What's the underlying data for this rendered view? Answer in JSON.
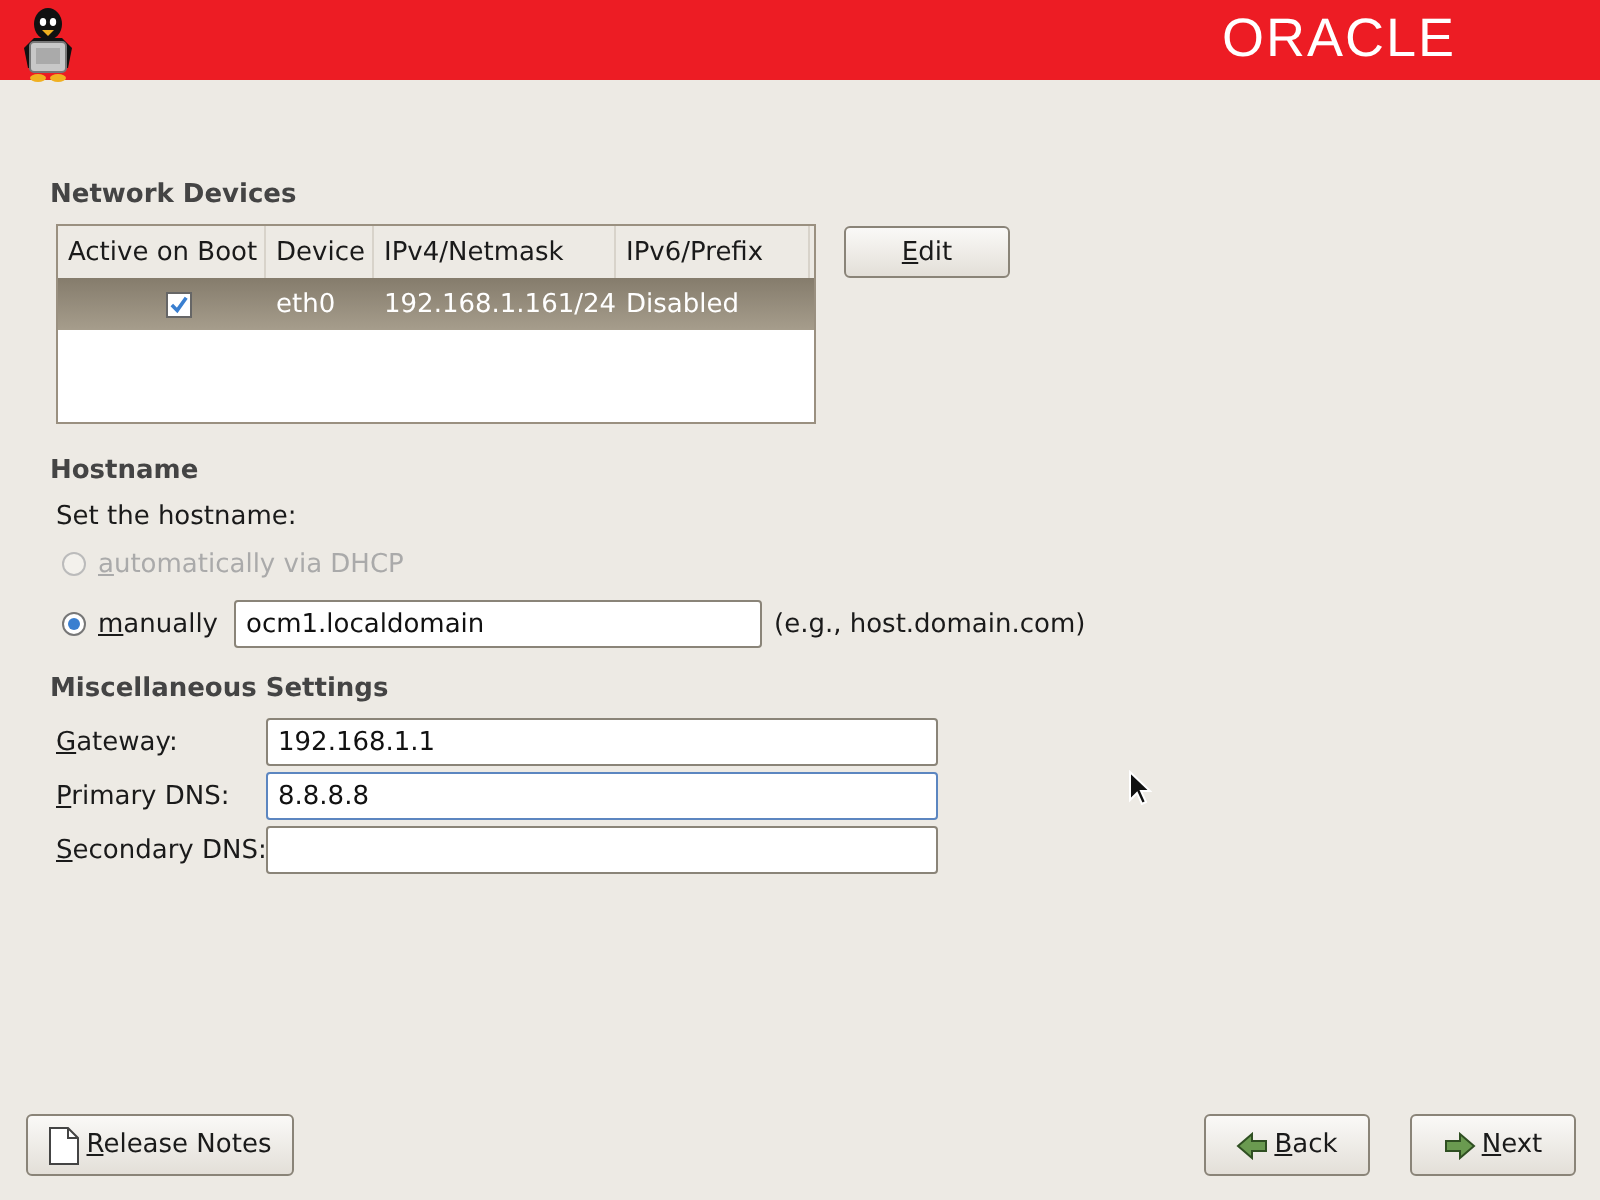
{
  "header": {
    "logo": "ORACLE"
  },
  "network_devices": {
    "title": "Network Devices",
    "columns": [
      "Active on Boot",
      "Device",
      "IPv4/Netmask",
      "IPv6/Prefix"
    ],
    "rows": [
      {
        "active_on_boot": true,
        "device": "eth0",
        "ipv4": "192.168.1.161/24",
        "ipv6": "Disabled",
        "selected": true
      }
    ],
    "edit_button": "Edit"
  },
  "hostname": {
    "title": "Hostname",
    "prompt": "Set the hostname:",
    "options": [
      {
        "kind": "radio",
        "label": "automatically via DHCP",
        "selected": false,
        "disabled": true
      },
      {
        "kind": "radio_field",
        "label": "manually",
        "selected": true,
        "disabled": false,
        "value": "ocm1.localdomain",
        "hint": "(e.g., host.domain.com)"
      }
    ]
  },
  "misc": {
    "title": "Miscellaneous Settings",
    "fields": [
      {
        "label": "Gateway:",
        "value": "192.168.1.1",
        "focused": false
      },
      {
        "label": "Primary DNS:",
        "value": "8.8.8.8",
        "focused": true
      },
      {
        "label": "Secondary DNS:",
        "focused": false
      }
    ]
  },
  "buttons": [
    {
      "kind": "notes",
      "label": "Release Notes"
    },
    {
      "kind": "back",
      "label": "Back"
    },
    {
      "kind": "next",
      "label": "Next"
    }
  ]
}
